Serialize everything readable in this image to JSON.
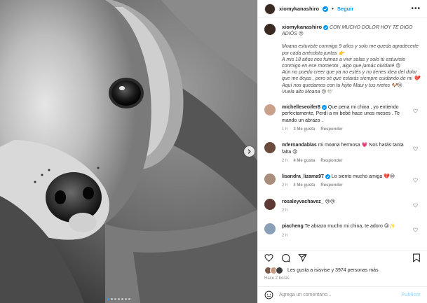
{
  "colors": {
    "accent": "#0095f6",
    "heart": "#ed4956",
    "muted": "#8e8e8e",
    "text": "#262626"
  },
  "photo": {
    "slides_total": 7,
    "active_slide": 1
  },
  "header": {
    "username": "xiomykanashiro",
    "separator": "•",
    "follow_label": "Seguir",
    "more_icon": "more-icon"
  },
  "caption": {
    "username": "xiomykanashiro",
    "headline": "CON MUCHO DOLOR HOY TE DIGO ADIÓS 😢",
    "lines": [
      "Moana estuviste conmigo 9 años y solo me queda agradecerte",
      "por cada anécdota juntas 👉",
      "A mis 18 años nos fuimos a vivir solas y solo tú estuviste",
      "conmigo en ese momento , algo que jamás olvidaré 😢",
      "Aún no puedo creer que ya no estés y no tienes idea del dolor",
      "que me dejas , pero sé que estarás siempre cuidando de mi 💔",
      "Aquí nos quedamos con tu hijito Maui y tus nietos 🐶😢",
      "Vuela alto Moana 😢🕊️"
    ]
  },
  "comments": [
    {
      "username": "michelleseoifer8",
      "verified": true,
      "text": "Que pena mi china , yo entiendo perfectamente, Perdí a mi bebé hace unos meses . Te mando un abrazo .",
      "time": "1 h",
      "likes": "3 Me gusta",
      "reply": "Responder"
    },
    {
      "username": "mfernandablas",
      "verified": false,
      "text": "mi moana hermosa 💗 Nos harás tanta falta 😢",
      "time": "2 h",
      "likes": "4 Me gusta",
      "reply": "Responder"
    },
    {
      "username": "lisandra_lizama97",
      "verified": true,
      "text": "Lo siento mucho amiga 💔😢",
      "time": "2 h",
      "likes": "4 Me gusta",
      "reply": "Responder"
    },
    {
      "username": "rosaleyvachavez_",
      "verified": false,
      "text": "😢😢",
      "time": "2 h",
      "likes": "",
      "reply": ""
    },
    {
      "username": "piacheng",
      "verified": false,
      "text": "Te abrazo mucho mi china, te adoro 😢✨",
      "time": "2 h",
      "likes": "",
      "reply": ""
    }
  ],
  "post_actions": {
    "like_icon": "heart-icon",
    "comment_icon": "comment-icon",
    "share_icon": "share-icon",
    "save_icon": "bookmark-icon"
  },
  "likes_text": "Les gusta a isisvise y 3974 personas más",
  "posted_time": "Hace 2 horas",
  "add_comment": {
    "placeholder": "Agrega un comentario...",
    "publish_label": "Publicar",
    "emoji_icon": "emoji-icon"
  }
}
